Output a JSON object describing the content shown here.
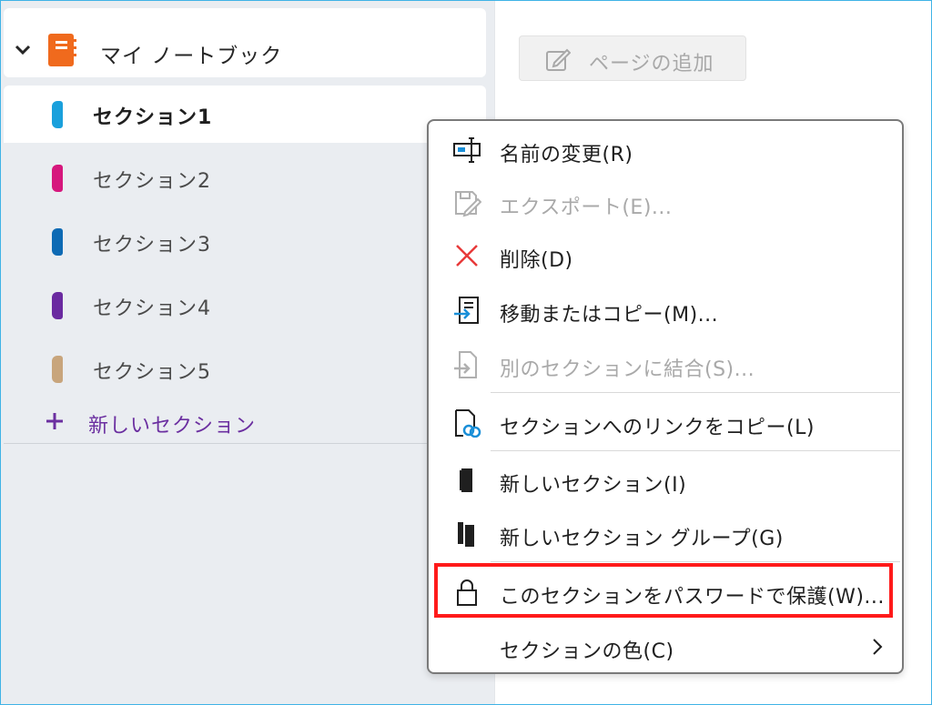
{
  "notebook": {
    "title": "マイ ノートブック",
    "icon": "notebook-icon",
    "color": "#f06a1d"
  },
  "sections": [
    {
      "label": "セクション1",
      "color": "#1aa0dc",
      "selected": true
    },
    {
      "label": "セクション2",
      "color": "#d6177d",
      "selected": false
    },
    {
      "label": "セクション3",
      "color": "#0e6ab4",
      "selected": false
    },
    {
      "label": "セクション4",
      "color": "#6a2aa0",
      "selected": false
    },
    {
      "label": "セクション5",
      "color": "#c8a57c",
      "selected": false
    }
  ],
  "new_section": {
    "label": "新しいセクション",
    "color": "#6b2fa0"
  },
  "page_pane": {
    "add_page_label": "ページの追加"
  },
  "context_menu": {
    "items": [
      {
        "label": "名前の変更(R)",
        "icon": "rename-icon",
        "enabled": true
      },
      {
        "label": "エクスポート(E)...",
        "icon": "export-icon",
        "enabled": false
      },
      {
        "label": "削除(D)",
        "icon": "delete-x-icon",
        "enabled": true
      },
      {
        "label": "移動またはコピー(M)...",
        "icon": "move-copy-icon",
        "enabled": true
      },
      {
        "label": "別のセクションに結合(S)...",
        "icon": "merge-icon",
        "enabled": false
      },
      {
        "label": "セクションへのリンクをコピー(L)",
        "icon": "copy-link-icon",
        "enabled": true
      },
      {
        "label": "新しいセクション(I)",
        "icon": "new-section-icon",
        "enabled": true
      },
      {
        "label": "新しいセクション グループ(G)",
        "icon": "new-section-group-icon",
        "enabled": true
      },
      {
        "label": "このセクションをパスワードで保護(W)...",
        "icon": "lock-icon",
        "enabled": true
      },
      {
        "label": "セクションの色(C)",
        "icon": "",
        "enabled": true
      }
    ]
  },
  "colors": {
    "highlight": "#ff1a1a",
    "delete_icon": "#e83a3a",
    "link_icon_accent": "#1a8fd8"
  }
}
